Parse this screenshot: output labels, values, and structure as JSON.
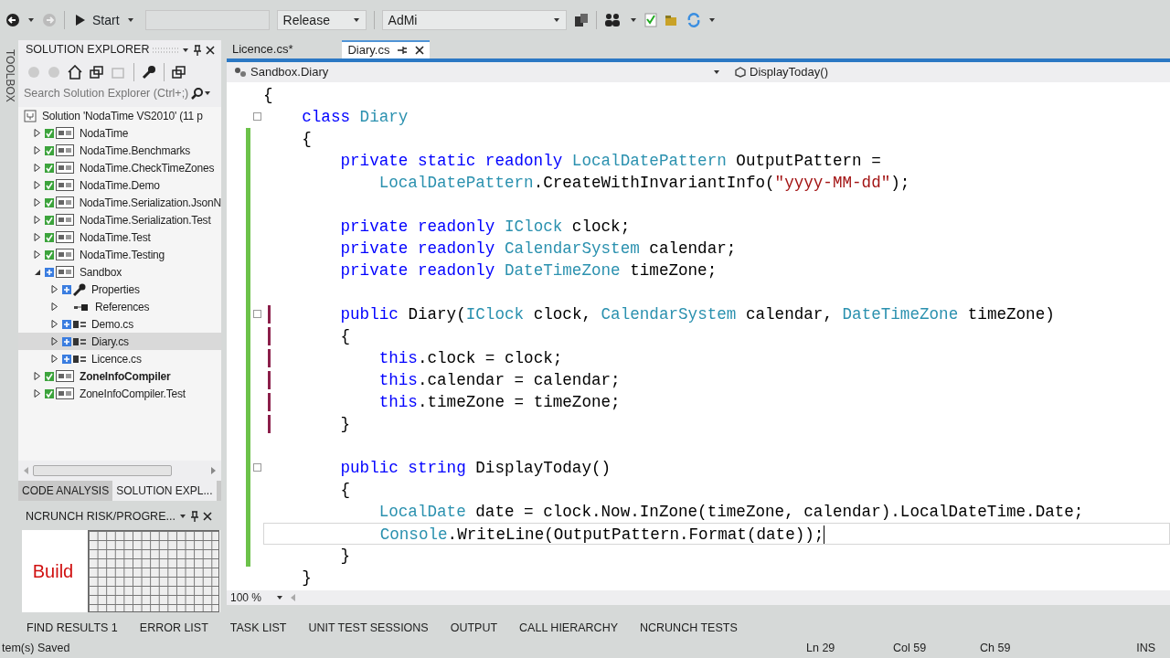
{
  "toolbar": {
    "start_label": "Start",
    "config": "Release",
    "platform": "AdMi"
  },
  "toolbox_label": "TOOLBOX",
  "solution_explorer": {
    "title": "SOLUTION EXPLORER",
    "search_placeholder": "Search Solution Explorer (Ctrl+;)",
    "tree": [
      {
        "label": "Solution 'NodaTime VS2010' (11 p",
        "kind": "solution",
        "selected": false,
        "children": [
          {
            "label": "NodaTime",
            "kind": "project",
            "added": false,
            "expanded": false,
            "startup": false,
            "selected": false
          },
          {
            "label": "NodaTime.Benchmarks",
            "kind": "project",
            "added": false,
            "expanded": false,
            "startup": false,
            "selected": false
          },
          {
            "label": "NodaTime.CheckTimeZones",
            "kind": "project",
            "added": false,
            "expanded": false,
            "startup": false,
            "selected": false
          },
          {
            "label": "NodaTime.Demo",
            "kind": "project",
            "added": false,
            "expanded": false,
            "startup": false,
            "selected": false
          },
          {
            "label": "NodaTime.Serialization.JsonN",
            "kind": "project",
            "added": false,
            "expanded": false,
            "startup": false,
            "selected": false
          },
          {
            "label": "NodaTime.Serialization.Test",
            "kind": "project",
            "added": false,
            "expanded": false,
            "startup": false,
            "selected": false
          },
          {
            "label": "NodaTime.Test",
            "kind": "project",
            "added": false,
            "expanded": false,
            "startup": false,
            "selected": false
          },
          {
            "label": "NodaTime.Testing",
            "kind": "project",
            "added": false,
            "expanded": false,
            "startup": false,
            "selected": false
          },
          {
            "label": "Sandbox",
            "kind": "project",
            "added": true,
            "expanded": true,
            "startup": false,
            "selected": false,
            "children": [
              {
                "label": "Properties",
                "kind": "folder",
                "added": true,
                "expanded": false,
                "selected": false
              },
              {
                "label": "References",
                "kind": "references",
                "expanded": false,
                "selected": false
              },
              {
                "label": "Demo.cs",
                "kind": "file",
                "added": true,
                "expanded": false,
                "selected": false
              },
              {
                "label": "Diary.cs",
                "kind": "file",
                "added": true,
                "expanded": false,
                "selected": true
              },
              {
                "label": "Licence.cs",
                "kind": "file",
                "added": true,
                "expanded": false,
                "selected": false
              }
            ]
          },
          {
            "label": "ZoneInfoCompiler",
            "kind": "project",
            "added": false,
            "expanded": false,
            "startup": true,
            "selected": false
          },
          {
            "label": "ZoneInfoCompiler.Test",
            "kind": "project",
            "added": false,
            "expanded": false,
            "startup": false,
            "selected": false
          }
        ]
      }
    ],
    "tabs": [
      {
        "label": "CODE ANALYSIS",
        "selected": false
      },
      {
        "label": "SOLUTION EXPL...",
        "selected": true
      }
    ]
  },
  "ncrunch": {
    "title": "NCRUNCH RISK/PROGRE...",
    "status": "Build"
  },
  "editor": {
    "tabs": [
      {
        "label": "Licence.cs*",
        "selected": false
      },
      {
        "label": "Diary.cs",
        "selected": true
      }
    ],
    "type_nav": "Sandbox.Diary",
    "member_nav": "DisplayToday()",
    "zoom": "100 %",
    "lines": [
      {
        "saved": false,
        "changed": false,
        "collapse": false,
        "current": false,
        "tokens": [
          {
            "text": "{",
            "kind": "plain"
          }
        ]
      },
      {
        "saved": false,
        "changed": false,
        "collapse": true,
        "current": false,
        "tokens": [
          {
            "text": "    class ",
            "kind": "keyword"
          },
          {
            "text": "Diary",
            "kind": "type"
          }
        ]
      },
      {
        "saved": true,
        "changed": false,
        "collapse": false,
        "current": false,
        "tokens": [
          {
            "text": "    {",
            "kind": "plain"
          }
        ]
      },
      {
        "saved": true,
        "changed": false,
        "collapse": false,
        "current": false,
        "tokens": [
          {
            "text": "        private static readonly ",
            "kind": "keyword"
          },
          {
            "text": "LocalDatePattern",
            "kind": "type"
          },
          {
            "text": " OutputPattern =",
            "kind": "plain"
          }
        ]
      },
      {
        "saved": true,
        "changed": false,
        "collapse": false,
        "current": false,
        "tokens": [
          {
            "text": "            LocalDatePattern",
            "kind": "type"
          },
          {
            "text": ".CreateWithInvariantInfo(",
            "kind": "plain"
          },
          {
            "text": "\"yyyy-MM-dd\"",
            "kind": "string"
          },
          {
            "text": ");",
            "kind": "plain"
          }
        ]
      },
      {
        "saved": true,
        "changed": false,
        "collapse": false,
        "current": false
      },
      {
        "saved": true,
        "changed": false,
        "collapse": false,
        "current": false,
        "tokens": [
          {
            "text": "        private readonly ",
            "kind": "keyword"
          },
          {
            "text": "IClock",
            "kind": "type"
          },
          {
            "text": " clock;",
            "kind": "plain"
          }
        ]
      },
      {
        "saved": true,
        "changed": false,
        "collapse": false,
        "current": false,
        "tokens": [
          {
            "text": "        private readonly ",
            "kind": "keyword"
          },
          {
            "text": "CalendarSystem",
            "kind": "type"
          },
          {
            "text": " calendar;",
            "kind": "plain"
          }
        ]
      },
      {
        "saved": true,
        "changed": false,
        "collapse": false,
        "current": false,
        "tokens": [
          {
            "text": "        private readonly ",
            "kind": "keyword"
          },
          {
            "text": "DateTimeZone",
            "kind": "type"
          },
          {
            "text": " timeZone;",
            "kind": "plain"
          }
        ]
      },
      {
        "saved": true,
        "changed": false,
        "collapse": false,
        "current": false
      },
      {
        "saved": true,
        "changed": true,
        "collapse": true,
        "current": false,
        "tokens": [
          {
            "text": "        public ",
            "kind": "keyword"
          },
          {
            "text": "Diary(",
            "kind": "plain"
          },
          {
            "text": "IClock",
            "kind": "type"
          },
          {
            "text": " clock, ",
            "kind": "plain"
          },
          {
            "text": "CalendarSystem",
            "kind": "type"
          },
          {
            "text": " calendar, ",
            "kind": "plain"
          },
          {
            "text": "DateTimeZone",
            "kind": "type"
          },
          {
            "text": " timeZone)",
            "kind": "plain"
          }
        ]
      },
      {
        "saved": true,
        "changed": true,
        "collapse": false,
        "current": false,
        "tokens": [
          {
            "text": "        {",
            "kind": "plain"
          }
        ]
      },
      {
        "saved": true,
        "changed": true,
        "collapse": false,
        "current": false,
        "tokens": [
          {
            "text": "            this",
            "kind": "keyword"
          },
          {
            "text": ".clock = clock;",
            "kind": "plain"
          }
        ]
      },
      {
        "saved": true,
        "changed": true,
        "collapse": false,
        "current": false,
        "tokens": [
          {
            "text": "            this",
            "kind": "keyword"
          },
          {
            "text": ".calendar = calendar;",
            "kind": "plain"
          }
        ]
      },
      {
        "saved": true,
        "changed": true,
        "collapse": false,
        "current": false,
        "tokens": [
          {
            "text": "            this",
            "kind": "keyword"
          },
          {
            "text": ".timeZone = timeZone;",
            "kind": "plain"
          }
        ]
      },
      {
        "saved": true,
        "changed": true,
        "collapse": false,
        "current": false,
        "tokens": [
          {
            "text": "        }",
            "kind": "plain"
          }
        ]
      },
      {
        "saved": true,
        "changed": false,
        "collapse": false,
        "current": false
      },
      {
        "saved": true,
        "changed": false,
        "collapse": true,
        "current": false,
        "tokens": [
          {
            "text": "        public string ",
            "kind": "keyword"
          },
          {
            "text": "DisplayToday()",
            "kind": "plain"
          }
        ]
      },
      {
        "saved": true,
        "changed": false,
        "collapse": false,
        "current": false,
        "tokens": [
          {
            "text": "        {",
            "kind": "plain"
          }
        ]
      },
      {
        "saved": true,
        "changed": false,
        "collapse": false,
        "current": false,
        "tokens": [
          {
            "text": "            LocalDate",
            "kind": "type"
          },
          {
            "text": " date = clock.Now.InZone(timeZone, calendar).LocalDateTime.Date;",
            "kind": "plain"
          }
        ]
      },
      {
        "saved": true,
        "changed": false,
        "collapse": false,
        "current": true,
        "tokens": [
          {
            "text": "            Console",
            "kind": "type"
          },
          {
            "text": ".WriteLine(OutputPattern.Format(date));",
            "kind": "plain"
          }
        ]
      },
      {
        "saved": true,
        "changed": false,
        "collapse": false,
        "current": false,
        "tokens": [
          {
            "text": "        }",
            "kind": "plain"
          }
        ]
      },
      {
        "saved": false,
        "changed": false,
        "collapse": false,
        "current": false,
        "tokens": [
          {
            "text": "    }",
            "kind": "plain"
          }
        ]
      }
    ]
  },
  "bottom_tabs": [
    "FIND RESULTS 1",
    "ERROR LIST",
    "TASK LIST",
    "UNIT TEST SESSIONS",
    "OUTPUT",
    "CALL HIERARCHY",
    "NCRUNCH TESTS"
  ],
  "status_bar": {
    "message": "tem(s) Saved",
    "line": "Ln 29",
    "column": "Col 59",
    "char": "Ch 59",
    "mode": "INS"
  }
}
